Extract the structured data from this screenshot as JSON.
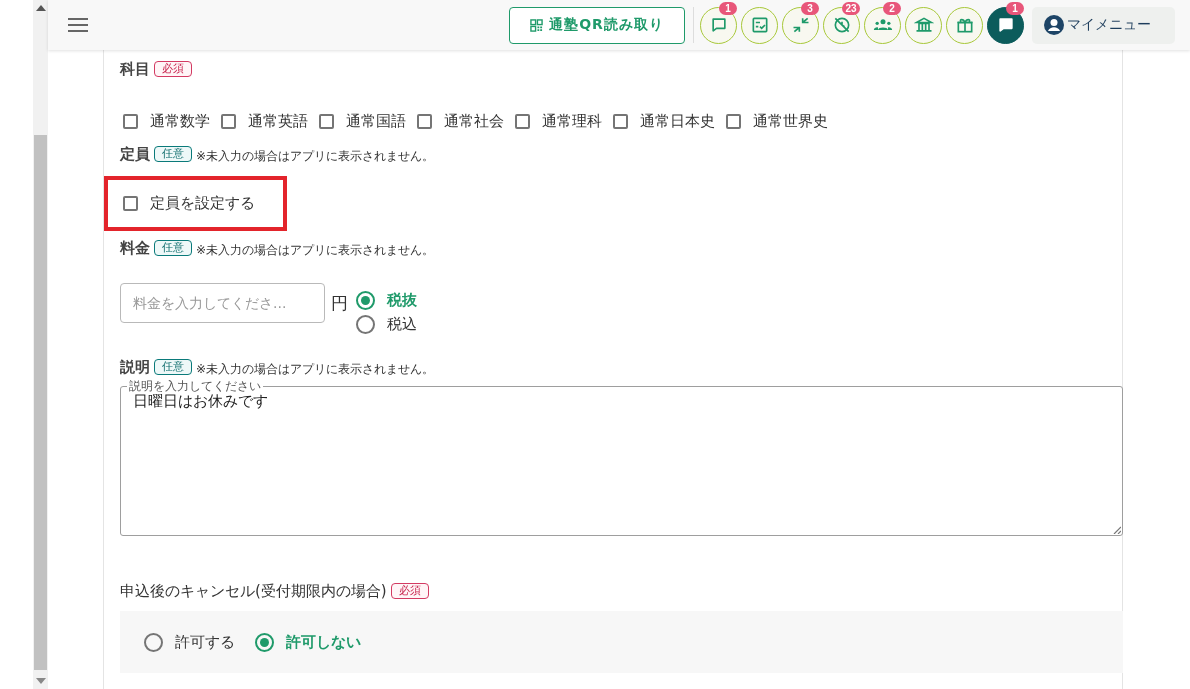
{
  "header": {
    "qr_button": "通塾QR読み取り",
    "tools": [
      {
        "badge": "1",
        "active": false
      },
      {
        "active": false
      },
      {
        "badge": "3",
        "active": false
      },
      {
        "badge": "23",
        "active": false
      },
      {
        "badge": "2",
        "active": false
      },
      {
        "active": false
      },
      {
        "active": false
      },
      {
        "badge": "1",
        "active": true
      }
    ],
    "my_menu": "マイメニュー"
  },
  "form": [
    {
      "kind": "checkbox-row",
      "label": "科目",
      "badge": {
        "text": "必須",
        "kind": "required"
      },
      "options": [
        {
          "label": "通常数学",
          "checked": false
        },
        {
          "label": "通常英語",
          "checked": false
        },
        {
          "label": "通常国語",
          "checked": false
        },
        {
          "label": "通常社会",
          "checked": false
        },
        {
          "label": "通常理科",
          "checked": false
        },
        {
          "label": "通常日本史",
          "checked": false
        },
        {
          "label": "通常世界史",
          "checked": false
        }
      ]
    },
    {
      "kind": "single-checkbox",
      "label": "定員",
      "badge": {
        "text": "任意",
        "kind": "optional"
      },
      "note": "※未入力の場合はアプリに表示されません。",
      "option": {
        "label": "定員を設定する",
        "checked": false,
        "highlighted": true
      }
    },
    {
      "kind": "price",
      "label": "料金",
      "badge": {
        "text": "任意",
        "kind": "optional"
      },
      "note": "※未入力の場合はアプリに表示されません。",
      "placeholder": "料金を入力してくださ...",
      "unit": "円",
      "options": [
        {
          "label": "税抜",
          "selected": true
        },
        {
          "label": "税込",
          "selected": false
        }
      ]
    },
    {
      "kind": "textarea",
      "label": "説明",
      "badge": {
        "text": "任意",
        "kind": "optional"
      },
      "note": "※未入力の場合はアプリに表示されません。",
      "field_label": "説明を入力してください",
      "value": "日曜日はお休みです"
    },
    {
      "kind": "radio-panel",
      "label": "申込後のキャンセル(受付期限内の場合)",
      "badge": {
        "text": "必須",
        "kind": "required"
      },
      "options": [
        {
          "label": "許可する",
          "selected": false
        },
        {
          "label": "許可しない",
          "selected": true
        }
      ]
    }
  ]
}
